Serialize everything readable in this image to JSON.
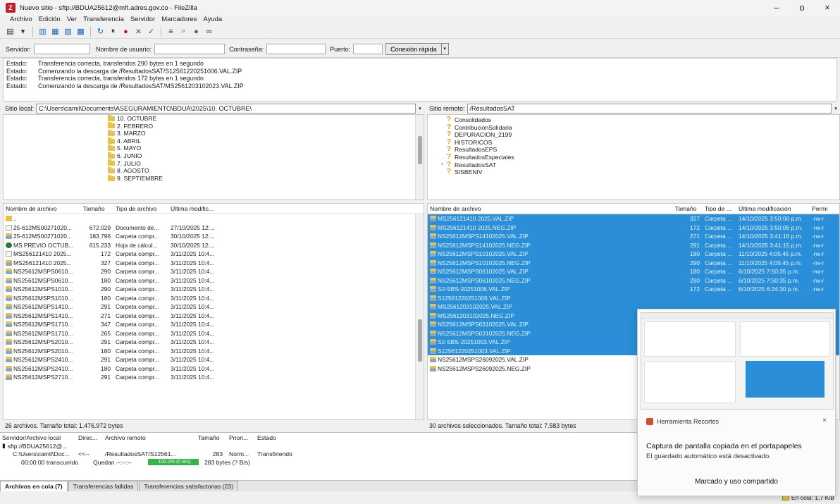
{
  "window": {
    "title": "Nuevo sitio - sftp://BDUA25612@mft.adres.gov.co - FileZilla",
    "minimize": "–",
    "maximize": "o",
    "close": "×"
  },
  "menu": [
    "Archivo",
    "Edición",
    "Ver",
    "Transferencia",
    "Servidor",
    "Marcadores",
    "Ayuda"
  ],
  "quickconnect": {
    "host_label": "Servidor:",
    "user_label": "Nombre de usuario:",
    "pass_label": "Contraseña:",
    "port_label": "Puerto:",
    "connect_button": "Conexión rápida",
    "dropdown": "▾"
  },
  "log": [
    {
      "k": "Estado:",
      "v": "Transferencia correcta, transferidos 290 bytes en 1 segundo"
    },
    {
      "k": "Estado:",
      "v": "Comenzando la descarga de /ResultadosSAT/S12561220251006.VAL.ZIP"
    },
    {
      "k": "Estado:",
      "v": "Transferencia correcta, transferidos 172 bytes en 1 segundo"
    },
    {
      "k": "Estado:",
      "v": "Comenzando la descarga de /ResultadosSAT/MS2561203102023.VAL.ZIP"
    }
  ],
  "local": {
    "site_label": "Sitio local:",
    "site_path": "C:\\Users\\camil\\Documents\\ASEGURAMIENTO\\BDUA\\2025\\10. OCTUBRE\\",
    "tree": [
      "10. OCTUBRE",
      "2. FEBRERO",
      "3. MARZO",
      "4. ABRIL",
      "5. MAYO",
      "6. JUNIO",
      "7. JULIO",
      "8. AGOSTO",
      "9. SEPTIEMBRE"
    ],
    "headers": [
      "Nombre de archivo",
      "Tamaño",
      "Tipo de archivo",
      "Última modific..."
    ],
    "files": [
      {
        "name": "..",
        "size": "",
        "type": "",
        "date": "",
        "icon": "up"
      },
      {
        "name": "25-612MS00271020...",
        "size": "672.029",
        "type": "Documento de...",
        "date": "27/10/2025 12:...",
        "icon": "doc"
      },
      {
        "name": "25-612MS00271020...",
        "size": "183.796",
        "type": "Carpeta compr...",
        "date": "30/10/2025 12:...",
        "icon": "zip"
      },
      {
        "name": "MS PREVIO OCTUB...",
        "size": "615.233",
        "type": "Hoja de cálcul...",
        "date": "30/10/2025 12:...",
        "icon": "xls"
      },
      {
        "name": "MS256121410 2025...",
        "size": "172",
        "type": "Carpeta compr...",
        "date": "3/11/2025 10:4...",
        "icon": "doc"
      },
      {
        "name": "MS256121410 2025...",
        "size": "327",
        "type": "Carpeta compr...",
        "date": "3/11/2025 10:4...",
        "icon": "zip"
      },
      {
        "name": "NS25612MSPS0610...",
        "size": "290",
        "type": "Carpeta compr...",
        "date": "3/11/2025 10:4...",
        "icon": "zip"
      },
      {
        "name": "NS25612MSPS0610...",
        "size": "180",
        "type": "Carpeta compr...",
        "date": "3/11/2025 10:4...",
        "icon": "zip"
      },
      {
        "name": "NS25612MSPS1010...",
        "size": "290",
        "type": "Carpeta compr...",
        "date": "3/11/2025 10:4...",
        "icon": "zip"
      },
      {
        "name": "NS25612MSPS1010...",
        "size": "180",
        "type": "Carpeta compr...",
        "date": "3/11/2025 10:4...",
        "icon": "zip"
      },
      {
        "name": "NS25612MSPS1410...",
        "size": "291",
        "type": "Carpeta compr...",
        "date": "3/11/2025 10:4...",
        "icon": "zip"
      },
      {
        "name": "NS25612MSPS1410...",
        "size": "271",
        "type": "Carpeta compr...",
        "date": "3/11/2025 10:4...",
        "icon": "zip"
      },
      {
        "name": "NS25612MSPS1710...",
        "size": "347",
        "type": "Carpeta compr...",
        "date": "3/11/2025 10:4...",
        "icon": "zip"
      },
      {
        "name": "NS25612MSPS1710...",
        "size": "265",
        "type": "Carpeta compr...",
        "date": "3/11/2025 10:4...",
        "icon": "zip"
      },
      {
        "name": "NS25612MSPS2010...",
        "size": "291",
        "type": "Carpeta compr...",
        "date": "3/11/2025 10:4...",
        "icon": "zip"
      },
      {
        "name": "NS25612MSPS2010...",
        "size": "180",
        "type": "Carpeta compr...",
        "date": "3/11/2025 10:4...",
        "icon": "zip"
      },
      {
        "name": "NS25612MSPS2410...",
        "size": "291",
        "type": "Carpeta compr...",
        "date": "3/11/2025 10:4...",
        "icon": "zip"
      },
      {
        "name": "NS25612MSPS2410...",
        "size": "180",
        "type": "Carpeta compr...",
        "date": "3/11/2025 10:4...",
        "icon": "zip"
      },
      {
        "name": "NS25612MSPS2710...",
        "size": "291",
        "type": "Carpeta compr...",
        "date": "3/11/2025 10:4...",
        "icon": "zip"
      }
    ],
    "status": "26 archivos. Tamaño total: 1.476.972 bytes"
  },
  "remote": {
    "site_label": "Sitio remoto:",
    "site_path": "/ResultadosSAT",
    "tree": [
      {
        "name": "Consolidados",
        "expander": ""
      },
      {
        "name": "ContribucionSolidaria",
        "expander": ""
      },
      {
        "name": "DEPURACION_2199",
        "expander": ""
      },
      {
        "name": "HISTORICOS",
        "expander": ""
      },
      {
        "name": "ResultadosEPS",
        "expander": ""
      },
      {
        "name": "ResultadosEspeciales",
        "expander": ""
      },
      {
        "name": "ResultadosSAT",
        "expander": "+"
      },
      {
        "name": "SISBENIV",
        "expander": ""
      }
    ],
    "headers": [
      "Nombre de archivo",
      "Tamaño",
      "Tipo de ...",
      "Última modificación",
      "Permi"
    ],
    "files": [
      {
        "name": "MS256121410 2025.VAL.ZIP",
        "size": "327",
        "type": "Carpeta ...",
        "date": "14/10/2025 3:50:06 p.m.",
        "perm": "-rw-r",
        "sel": true
      },
      {
        "name": "MS256121410 2025.NEG.ZIP",
        "size": "172",
        "type": "Carpeta ...",
        "date": "14/10/2025 3:50:06 p.m.",
        "perm": "-rw-r",
        "sel": true
      },
      {
        "name": "NS25612MSPS14102025.VAL.ZIP",
        "size": "271",
        "type": "Carpeta ...",
        "date": "14/10/2025 3:41:16 p.m.",
        "perm": "-rw-r",
        "sel": true
      },
      {
        "name": "NS25612MSPS14102025.NEG.ZIP",
        "size": "291",
        "type": "Carpeta ...",
        "date": "14/10/2025 3:41:15 p.m.",
        "perm": "-rw-r",
        "sel": true
      },
      {
        "name": "NS25612MSPS10102025.VAL.ZIP",
        "size": "180",
        "type": "Carpeta ...",
        "date": "11/10/2025 4:05:45 p.m.",
        "perm": "-rw-r",
        "sel": true
      },
      {
        "name": "NS25612MSPS10102025.NEG.ZIP",
        "size": "290",
        "type": "Carpeta ...",
        "date": "11/10/2025 4:05:45 p.m.",
        "perm": "-rw-r",
        "sel": true
      },
      {
        "name": "NS25612MSPS06102025.VAL.ZIP",
        "size": "180",
        "type": "Carpeta ...",
        "date": "6/10/2025 7:50:35 p.m.",
        "perm": "-rw-r",
        "sel": true
      },
      {
        "name": "NS25612MSPS06102025.NEG.ZIP",
        "size": "290",
        "type": "Carpeta ...",
        "date": "6/10/2025 7:50:35 p.m.",
        "perm": "-rw-r",
        "sel": true
      },
      {
        "name": "S2-SBS-20251006.VAL.ZIP",
        "size": "172",
        "type": "Carpeta ...",
        "date": "6/10/2025 6:24:30 p.m.",
        "perm": "-rw-r",
        "sel": true
      },
      {
        "name": "S12561220251006.VAL.ZIP",
        "size": "",
        "type": "",
        "date": "",
        "perm": "",
        "sel": true
      },
      {
        "name": "MS2561203102025.VAL.ZIP",
        "size": "",
        "type": "",
        "date": "",
        "perm": "",
        "sel": true
      },
      {
        "name": "MS2561203102025.NEG.ZIP",
        "size": "",
        "type": "",
        "date": "",
        "perm": "",
        "sel": true
      },
      {
        "name": "NS25612MSPS03102025.VAL.ZIP",
        "size": "",
        "type": "",
        "date": "",
        "perm": "",
        "sel": true
      },
      {
        "name": "NS25612MSPS03102025.NEG.ZIP",
        "size": "",
        "type": "",
        "date": "",
        "perm": "",
        "sel": true
      },
      {
        "name": "S2-SBS-20251003.VAL.ZIP",
        "size": "",
        "type": "",
        "date": "",
        "perm": "",
        "sel": true
      },
      {
        "name": "S12561220251003.VAL.ZIP",
        "size": "",
        "type": "",
        "date": "",
        "perm": "",
        "sel": true
      },
      {
        "name": "NS25612MSPS26092025.VAL.ZIP",
        "size": "",
        "type": "",
        "date": "",
        "perm": "",
        "sel": false
      },
      {
        "name": "NS25612MSPS26092025.NEG.ZIP",
        "size": "",
        "type": "",
        "date": "",
        "perm": "",
        "sel": false
      }
    ],
    "status": "30 archivos seleccionados. Tamaño total: 7.583 bytes"
  },
  "queue": {
    "headers": [
      "Servidor/Archivo local",
      "Direc...",
      "Archivo remoto",
      "Tamaño",
      "Priori...",
      "Estado"
    ],
    "server": "sftp://BDUA25612@...",
    "row": {
      "local": "C:\\Users\\camil\\Doc...",
      "dir": "<<--",
      "remote": "/ResultadosSAT/S12561...",
      "size": "283",
      "prio": "Norm...",
      "state": "Transfiriendo"
    },
    "progress": {
      "elapsed": "00:00:00 transcurrido",
      "left": "Quedan --:--:--",
      "bar": "100.0% (0 B/s)",
      "bytes": "283 bytes (? B/s)",
      "percent": 100
    }
  },
  "tabs": [
    "Archivos en cola (7)",
    "Transferencias fallidas",
    "Transferencias satisfactorias (23)"
  ],
  "statusbar": {
    "queue": "En cola: 1,7 KiB"
  },
  "toast": {
    "app": "Herramienta Recortes",
    "title": "Captura de pantalla copiada en el portapapeles",
    "body": "El guardado automático está desactivado.",
    "action": "Marcado y uso compartido",
    "close": "×"
  },
  "colors": {
    "selection": "#2a8fd8",
    "folder": "#e8c24a",
    "progress": "#36b34a",
    "brand": "#c0202a"
  }
}
